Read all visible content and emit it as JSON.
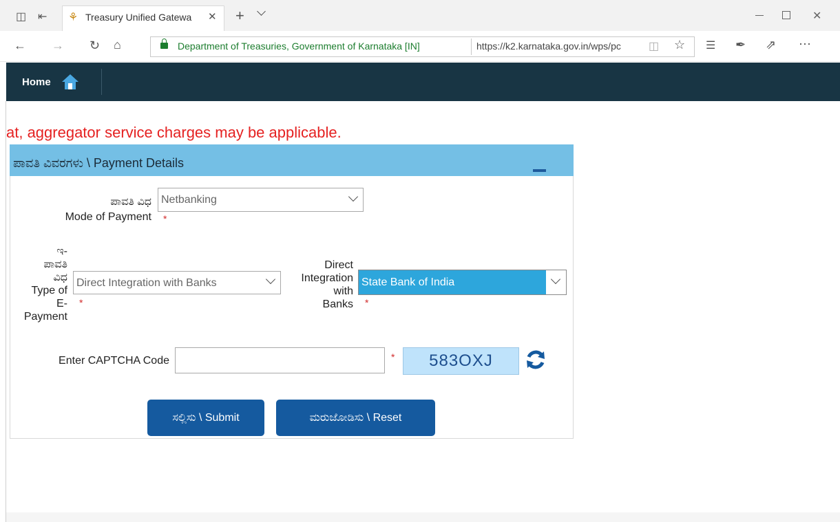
{
  "browser": {
    "tab_title": "Treasury Unified Gatewa",
    "new_tab": "+",
    "site_identity": "Department of Treasuries, Government of Karnataka [IN]",
    "url": "https://k2.karnataka.gov.in/wps/pc"
  },
  "header": {
    "home_label": "Home"
  },
  "notice": "at, aggregator service charges may be applicable.",
  "panel": {
    "title": "ಪಾವತಿ ವಿವರಗಳು \\ Payment Details",
    "mode_label_kn": "ಪಾವತಿ ವಿಧ",
    "mode_label_en": "Mode of Payment",
    "mode_value": "Netbanking",
    "type_label_lines": [
      "ಇ-",
      "ಪಾವತಿ",
      "ವಿಧ",
      "Type of",
      "E-",
      "Payment"
    ],
    "type_value": "Direct Integration with Banks",
    "bank_label_lines": [
      "Direct",
      "Integration",
      "with",
      "Banks"
    ],
    "bank_value": "State Bank of India",
    "captcha_label": "Enter CAPTCHA Code",
    "captcha_value": "",
    "captcha_code": "583OXJ",
    "required_mark": "*",
    "submit_label": "ಸಲ್ಲಿಸು \\ Submit",
    "reset_label": "ಮರುಜೋಡಿಸು \\ Reset"
  },
  "colors": {
    "header_bg": "#183544",
    "panel_head": "#74bfe5",
    "button": "#155a9f",
    "notice": "#e52121"
  }
}
